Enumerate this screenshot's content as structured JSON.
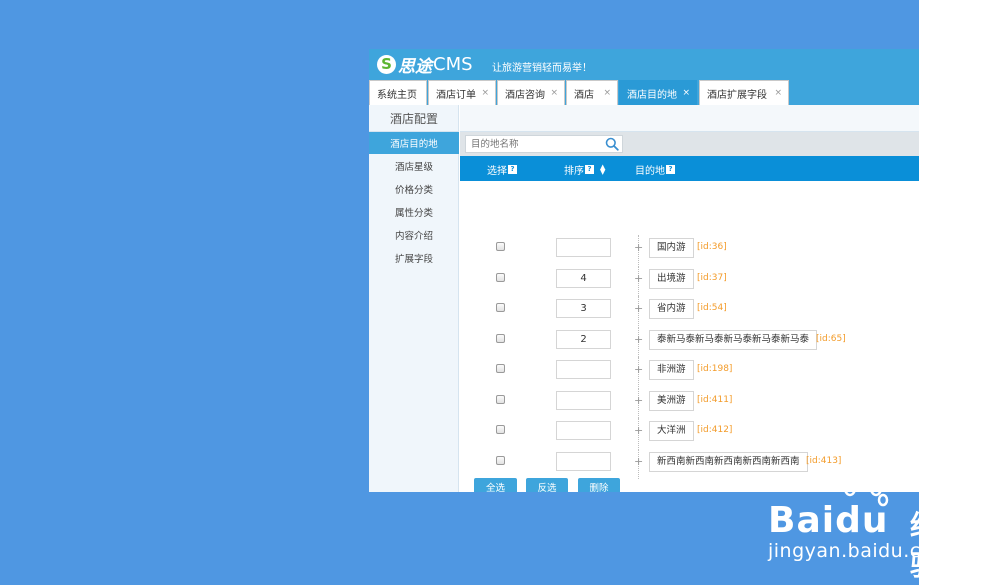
{
  "app": {
    "logo_mark": "S",
    "logo_cn": "思途",
    "logo_cms": "CMS",
    "slogan": "让旅游营销轻而易举！"
  },
  "tabs": [
    {
      "label": "系统主页",
      "closable": false,
      "active": false
    },
    {
      "label": "酒店订单",
      "closable": true,
      "active": false
    },
    {
      "label": "酒店咨询",
      "closable": true,
      "active": false
    },
    {
      "label": "酒店",
      "closable": true,
      "active": false
    },
    {
      "label": "酒店目的地",
      "closable": true,
      "active": true
    },
    {
      "label": "酒店扩展字段",
      "closable": true,
      "active": false
    }
  ],
  "tab_close_glyph": "×",
  "sidebar": {
    "title": "酒店配置",
    "items": [
      {
        "label": "酒店目的地",
        "active": true
      },
      {
        "label": "酒店星级",
        "active": false
      },
      {
        "label": "价格分类",
        "active": false
      },
      {
        "label": "属性分类",
        "active": false
      },
      {
        "label": "内容介绍",
        "active": false
      },
      {
        "label": "扩展字段",
        "active": false
      }
    ]
  },
  "search": {
    "placeholder": "目的地名称",
    "icon": "search-icon"
  },
  "table": {
    "columns": {
      "select": "选择",
      "order": "排序",
      "destination": "目的地"
    },
    "help_glyph": "?",
    "expand_glyph": "+",
    "rows": [
      {
        "order": "",
        "name": "国内游",
        "id": "[id:36]"
      },
      {
        "order": "4",
        "name": "出境游",
        "id": "[id:37]"
      },
      {
        "order": "3",
        "name": "省内游",
        "id": "[id:54]"
      },
      {
        "order": "2",
        "name": "泰新马泰新马泰新马泰新马泰新马泰",
        "id": "[id:65]"
      },
      {
        "order": "",
        "name": "非洲游",
        "id": "[id:198]"
      },
      {
        "order": "",
        "name": "美洲游",
        "id": "[id:411]"
      },
      {
        "order": "",
        "name": "大洋洲",
        "id": "[id:412]"
      },
      {
        "order": "",
        "name": "新西南新西南新西南新西南新西南",
        "id": "[id:413]"
      }
    ]
  },
  "actions": {
    "select_all": "全选",
    "invert": "反选",
    "delete": "删除"
  },
  "watermark": {
    "brand": "Bai",
    "brand_tail": "du",
    "jingyan": "经验",
    "url": "jingyan.baidu.com"
  },
  "colors": {
    "page_bg": "#4f97e2",
    "brand_blue": "#3ea5dc",
    "header_blue": "#0a8fd8",
    "id_orange": "#f39c2b"
  }
}
